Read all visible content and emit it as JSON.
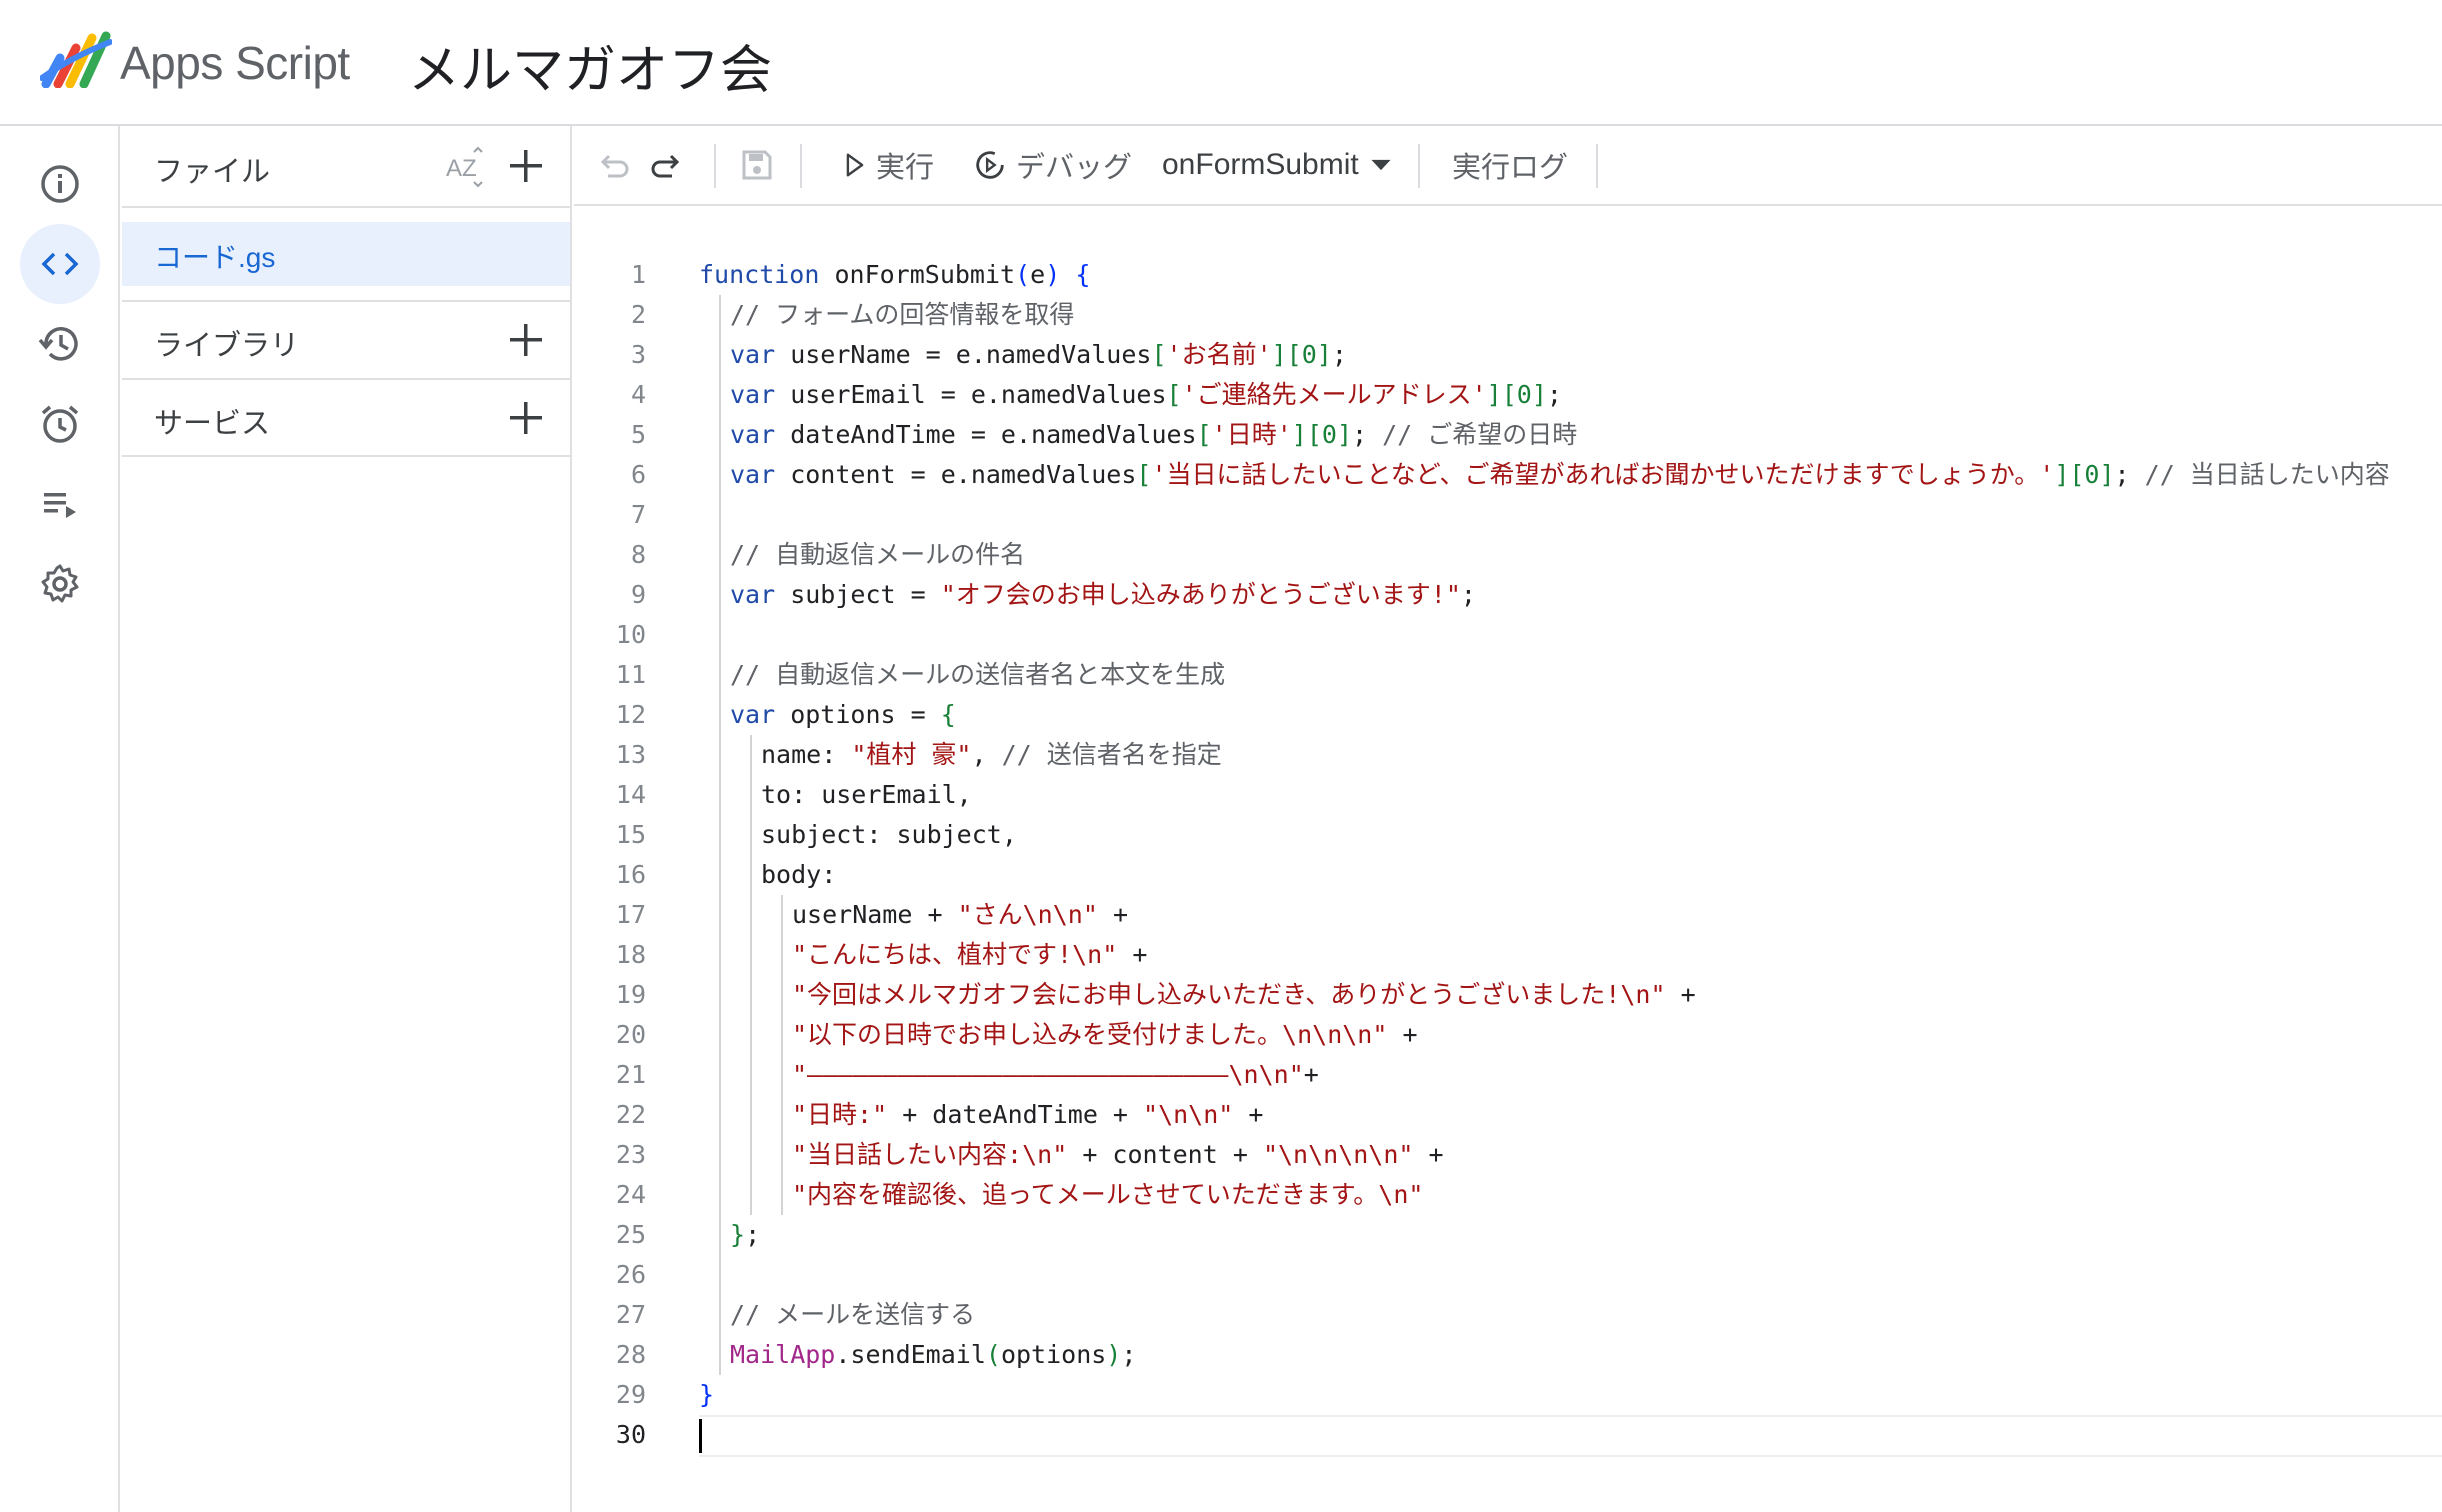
{
  "header": {
    "app_name": "Apps Script",
    "project_title": "メルマガオフ会"
  },
  "rail": {
    "items": [
      {
        "name": "overview",
        "icon": "info-icon"
      },
      {
        "name": "editor",
        "icon": "code-icon",
        "active": true
      },
      {
        "name": "history",
        "icon": "history-icon"
      },
      {
        "name": "triggers",
        "icon": "alarm-icon"
      },
      {
        "name": "executions",
        "icon": "executions-icon"
      },
      {
        "name": "settings",
        "icon": "gear-icon"
      }
    ]
  },
  "files": {
    "header_label": "ファイル",
    "sort_icon": "sort-az-icon",
    "add_icon": "plus-icon",
    "file_name": "コード.gs",
    "libraries_label": "ライブラリ",
    "services_label": "サービス"
  },
  "toolbar": {
    "undo_icon": "undo-icon",
    "redo_icon": "redo-icon",
    "save_icon": "save-icon",
    "run_label": "実行",
    "debug_label": "デバッグ",
    "function_select": "onFormSubmit",
    "log_label": "実行ログ"
  },
  "colors": {
    "accent": "#1967d2",
    "active_bg": "#e8f0fe",
    "string": "#a31515",
    "keyword": "#1f4aa8",
    "comment": "#5f6368"
  },
  "editor": {
    "current_line": 30,
    "lines": [
      {
        "n": "1",
        "indent": 0,
        "tokens": [
          {
            "t": "function",
            "c": "kv"
          },
          {
            "t": " onFormSubmit",
            "c": "fn"
          },
          {
            "t": "(",
            "c": "bb"
          },
          {
            "t": "e",
            "c": "fn"
          },
          {
            "t": ")",
            "c": "bb"
          },
          {
            "t": " ",
            "c": "fn"
          },
          {
            "t": "{",
            "c": "bb"
          }
        ]
      },
      {
        "n": "2",
        "indent": 1,
        "tokens": [
          {
            "t": "// フォームの回答情報を取得",
            "c": "c"
          }
        ]
      },
      {
        "n": "3",
        "indent": 1,
        "tokens": [
          {
            "t": "var",
            "c": "kv"
          },
          {
            "t": " userName = e.namedValues",
            "c": "fn"
          },
          {
            "t": "[",
            "c": "br"
          },
          {
            "t": "'お名前'",
            "c": "s"
          },
          {
            "t": "][",
            "c": "br"
          },
          {
            "t": "0",
            "c": "br"
          },
          {
            "t": "]",
            "c": "br"
          },
          {
            "t": ";",
            "c": "fn"
          }
        ]
      },
      {
        "n": "4",
        "indent": 1,
        "tokens": [
          {
            "t": "var",
            "c": "kv"
          },
          {
            "t": " userEmail = e.namedValues",
            "c": "fn"
          },
          {
            "t": "[",
            "c": "br"
          },
          {
            "t": "'ご連絡先メールアドレス'",
            "c": "s"
          },
          {
            "t": "][",
            "c": "br"
          },
          {
            "t": "0",
            "c": "br"
          },
          {
            "t": "]",
            "c": "br"
          },
          {
            "t": ";",
            "c": "fn"
          }
        ]
      },
      {
        "n": "5",
        "indent": 1,
        "tokens": [
          {
            "t": "var",
            "c": "kv"
          },
          {
            "t": " dateAndTime = e.namedValues",
            "c": "fn"
          },
          {
            "t": "[",
            "c": "br"
          },
          {
            "t": "'日時'",
            "c": "s"
          },
          {
            "t": "][",
            "c": "br"
          },
          {
            "t": "0",
            "c": "br"
          },
          {
            "t": "]",
            "c": "br"
          },
          {
            "t": "; ",
            "c": "fn"
          },
          {
            "t": "// ご希望の日時",
            "c": "c"
          }
        ]
      },
      {
        "n": "6",
        "indent": 1,
        "tokens": [
          {
            "t": "var",
            "c": "kv"
          },
          {
            "t": " content = e.namedValues",
            "c": "fn"
          },
          {
            "t": "[",
            "c": "br"
          },
          {
            "t": "'当日に話したいことなど、ご希望があればお聞かせいただけますでしょうか。'",
            "c": "s"
          },
          {
            "t": "][",
            "c": "br"
          },
          {
            "t": "0",
            "c": "br"
          },
          {
            "t": "]",
            "c": "br"
          },
          {
            "t": "; ",
            "c": "fn"
          },
          {
            "t": "// 当日話したい内容",
            "c": "c"
          }
        ]
      },
      {
        "n": "7",
        "indent": 1,
        "tokens": []
      },
      {
        "n": "8",
        "indent": 1,
        "tokens": [
          {
            "t": "// 自動返信メールの件名",
            "c": "c"
          }
        ]
      },
      {
        "n": "9",
        "indent": 1,
        "tokens": [
          {
            "t": "var",
            "c": "kv"
          },
          {
            "t": " subject = ",
            "c": "fn"
          },
          {
            "t": "\"オフ会のお申し込みありがとうございます!\"",
            "c": "s"
          },
          {
            "t": ";",
            "c": "fn"
          }
        ]
      },
      {
        "n": "10",
        "indent": 1,
        "tokens": []
      },
      {
        "n": "11",
        "indent": 1,
        "tokens": [
          {
            "t": "// 自動返信メールの送信者名と本文を生成",
            "c": "c"
          }
        ]
      },
      {
        "n": "12",
        "indent": 1,
        "tokens": [
          {
            "t": "var",
            "c": "kv"
          },
          {
            "t": " options = ",
            "c": "fn"
          },
          {
            "t": "{",
            "c": "br"
          }
        ]
      },
      {
        "n": "13",
        "indent": 2,
        "tokens": [
          {
            "t": "name: ",
            "c": "fn"
          },
          {
            "t": "\"植村 豪\"",
            "c": "s"
          },
          {
            "t": ", ",
            "c": "fn"
          },
          {
            "t": "// 送信者名を指定",
            "c": "c"
          }
        ]
      },
      {
        "n": "14",
        "indent": 2,
        "tokens": [
          {
            "t": "to: userEmail,",
            "c": "fn"
          }
        ]
      },
      {
        "n": "15",
        "indent": 2,
        "tokens": [
          {
            "t": "subject: subject,",
            "c": "fn"
          }
        ]
      },
      {
        "n": "16",
        "indent": 2,
        "tokens": [
          {
            "t": "body:",
            "c": "fn"
          }
        ]
      },
      {
        "n": "17",
        "indent": 3,
        "tokens": [
          {
            "t": "userName + ",
            "c": "fn"
          },
          {
            "t": "\"さん\\n\\n\"",
            "c": "s"
          },
          {
            "t": " +",
            "c": "fn"
          }
        ]
      },
      {
        "n": "18",
        "indent": 3,
        "tokens": [
          {
            "t": "\"こんにちは、植村です!\\n\"",
            "c": "s"
          },
          {
            "t": " +",
            "c": "fn"
          }
        ]
      },
      {
        "n": "19",
        "indent": 3,
        "tokens": [
          {
            "t": "\"今回はメルマガオフ会にお申し込みいただき、ありがとうございました!\\n\"",
            "c": "s"
          },
          {
            "t": " +",
            "c": "fn"
          }
        ]
      },
      {
        "n": "20",
        "indent": 3,
        "tokens": [
          {
            "t": "\"以下の日時でお申し込みを受付けました。\\n\\n\\n\"",
            "c": "s"
          },
          {
            "t": " +",
            "c": "fn"
          }
        ]
      },
      {
        "n": "21",
        "indent": 3,
        "tokens": [
          {
            "t": "\"————————————————————————————\\n\\n\"",
            "c": "s"
          },
          {
            "t": "+",
            "c": "fn"
          }
        ]
      },
      {
        "n": "22",
        "indent": 3,
        "tokens": [
          {
            "t": "\"日時:\"",
            "c": "s"
          },
          {
            "t": " + dateAndTime + ",
            "c": "fn"
          },
          {
            "t": "\"\\n\\n\"",
            "c": "s"
          },
          {
            "t": " +",
            "c": "fn"
          }
        ]
      },
      {
        "n": "23",
        "indent": 3,
        "tokens": [
          {
            "t": "\"当日話したい内容:\\n\"",
            "c": "s"
          },
          {
            "t": " + content + ",
            "c": "fn"
          },
          {
            "t": "\"\\n\\n\\n\\n\"",
            "c": "s"
          },
          {
            "t": " +",
            "c": "fn"
          }
        ]
      },
      {
        "n": "24",
        "indent": 3,
        "tokens": [
          {
            "t": "\"内容を確認後、追ってメールさせていただきます。\\n\"",
            "c": "s"
          }
        ]
      },
      {
        "n": "25",
        "indent": 1,
        "tokens": [
          {
            "t": "}",
            "c": "br"
          },
          {
            "t": ";",
            "c": "fn"
          }
        ]
      },
      {
        "n": "26",
        "indent": 1,
        "tokens": []
      },
      {
        "n": "27",
        "indent": 1,
        "tokens": [
          {
            "t": "// メールを送信する",
            "c": "c"
          }
        ]
      },
      {
        "n": "28",
        "indent": 1,
        "tokens": [
          {
            "t": "MailApp",
            "c": "cls"
          },
          {
            "t": ".sendEmail",
            "c": "fn"
          },
          {
            "t": "(",
            "c": "br"
          },
          {
            "t": "options",
            "c": "fn"
          },
          {
            "t": ")",
            "c": "br"
          },
          {
            "t": ";",
            "c": "fn"
          }
        ]
      },
      {
        "n": "29",
        "indent": 0,
        "tokens": [
          {
            "t": "}",
            "c": "bb"
          }
        ]
      },
      {
        "n": "30",
        "indent": 0,
        "tokens": []
      }
    ]
  }
}
